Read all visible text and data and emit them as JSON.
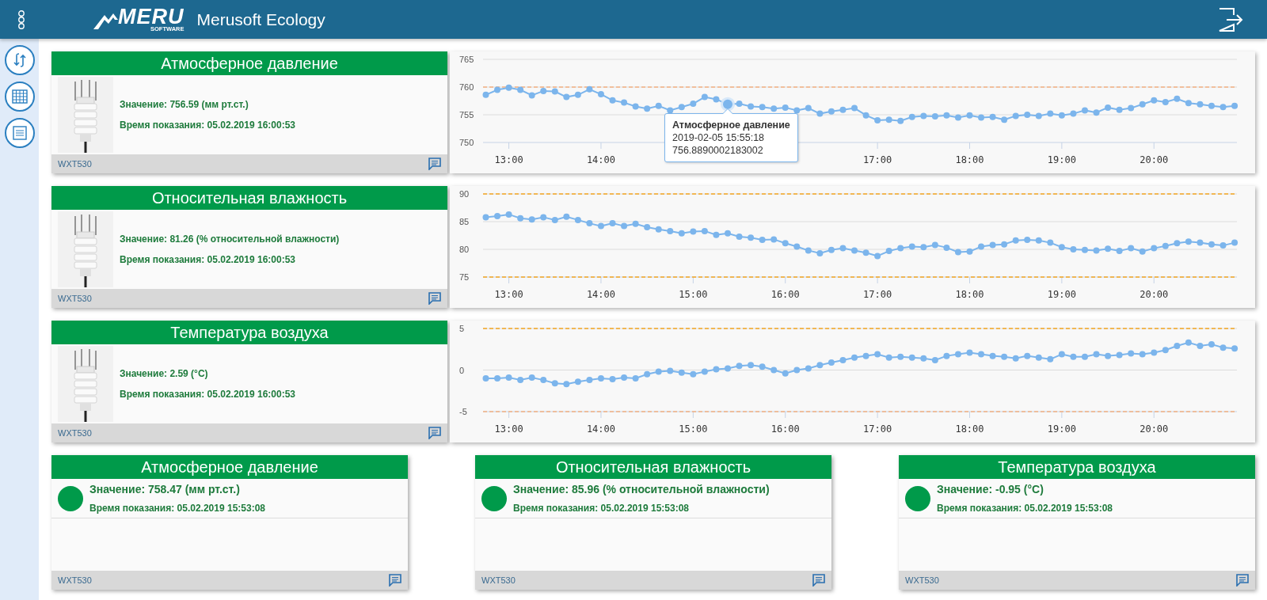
{
  "header": {
    "logo": {
      "text": "MERU",
      "subtext": "SOFTWARE"
    },
    "title": "Merusoft Ecology"
  },
  "sensor_rows": [
    {
      "title": "Атмосферное давление",
      "value": "Значение: 756.59 (мм рт.ст.)",
      "time": "Время показания: 05.02.2019 16:00:53",
      "device": "WXT530",
      "chart_data": {
        "type": "line",
        "xlim": [
          12.72,
          20.9
        ],
        "ylim": [
          750,
          765
        ],
        "yticks": [
          750,
          755,
          760,
          765
        ],
        "xticks": [
          {
            "value": 13,
            "label": "13:00"
          },
          {
            "value": 14,
            "label": "14:00"
          },
          {
            "value": 17,
            "label": "17:00"
          },
          {
            "value": 18,
            "label": "18:00"
          },
          {
            "value": 19,
            "label": "19:00"
          },
          {
            "value": 20,
            "label": "20:00"
          }
        ],
        "x": [
          12.75,
          12.875,
          13,
          13.125,
          13.25,
          13.375,
          13.5,
          13.625,
          13.75,
          13.875,
          14,
          14.125,
          14.25,
          14.375,
          14.5,
          14.625,
          14.75,
          14.875,
          15,
          15.125,
          15.25,
          15.375,
          15.5,
          15.625,
          15.75,
          15.875,
          16,
          16.125,
          16.25,
          16.375,
          16.5,
          16.625,
          16.75,
          16.875,
          17,
          17.125,
          17.25,
          17.375,
          17.5,
          17.625,
          17.75,
          17.875,
          18,
          18.125,
          18.25,
          18.375,
          18.5,
          18.625,
          18.75,
          18.875,
          19,
          19.125,
          19.25,
          19.375,
          19.5,
          19.625,
          19.75,
          19.875,
          20,
          20.125,
          20.25,
          20.375,
          20.5,
          20.625,
          20.75,
          20.875
        ],
        "series": [
          {
            "name": "Атмосферное давление",
            "color": "#7cb5ec",
            "marker": "circle",
            "values": [
              758.6,
              759.5,
              759.9,
              759.5,
              758.5,
              759.3,
              759.2,
              758.2,
              758.6,
              759.6,
              758.7,
              757.6,
              757.2,
              756.5,
              756.1,
              756.6,
              755.8,
              756.4,
              757.0,
              758.2,
              757.8,
              756.9,
              757.0,
              756.5,
              756.4,
              756.1,
              756.3,
              755.8,
              756.2,
              755.2,
              755.6,
              755.9,
              756.2,
              754.9,
              754.0,
              754.1,
              753.9,
              754.6,
              754.8,
              754.7,
              754.9,
              754.5,
              754.9,
              754.5,
              754.6,
              754.1,
              754.8,
              755.0,
              754.8,
              755.2,
              754.9,
              755.2,
              755.8,
              755.4,
              756.3,
              755.9,
              756.2,
              756.9,
              757.6,
              757.3,
              757.9,
              757.1,
              756.9,
              756.6,
              756.4,
              756.6
            ]
          }
        ],
        "ref_lines": [
          {
            "axis": "y",
            "value": 760,
            "color": "#f4b183"
          }
        ],
        "annotations": [
          {
            "x": 15.375,
            "y": 756.9,
            "text": "2019-02-05 15:55:18\n756.8890002183002"
          }
        ]
      }
    },
    {
      "title": "Относительная влажность",
      "value": "Значение: 81.26 (% относительной влажности)",
      "time": "Время показания: 05.02.2019 16:00:53",
      "device": "WXT530",
      "chart_data": {
        "type": "line",
        "xlim": [
          12.72,
          20.9
        ],
        "ylim": [
          75,
          90
        ],
        "yticks": [
          75,
          80,
          85,
          90
        ],
        "xticks": [
          {
            "value": 13,
            "label": "13:00"
          },
          {
            "value": 14,
            "label": "14:00"
          },
          {
            "value": 15,
            "label": "15:00"
          },
          {
            "value": 16,
            "label": "16:00"
          },
          {
            "value": 17,
            "label": "17:00"
          },
          {
            "value": 18,
            "label": "18:00"
          },
          {
            "value": 19,
            "label": "19:00"
          },
          {
            "value": 20,
            "label": "20:00"
          }
        ],
        "x": [
          12.75,
          12.875,
          13,
          13.125,
          13.25,
          13.375,
          13.5,
          13.625,
          13.75,
          13.875,
          14,
          14.125,
          14.25,
          14.375,
          14.5,
          14.625,
          14.75,
          14.875,
          15,
          15.125,
          15.25,
          15.375,
          15.5,
          15.625,
          15.75,
          15.875,
          16,
          16.125,
          16.25,
          16.375,
          16.5,
          16.625,
          16.75,
          16.875,
          17,
          17.125,
          17.25,
          17.375,
          17.5,
          17.625,
          17.75,
          17.875,
          18,
          18.125,
          18.25,
          18.375,
          18.5,
          18.625,
          18.75,
          18.875,
          19,
          19.125,
          19.25,
          19.375,
          19.5,
          19.625,
          19.75,
          19.875,
          20,
          20.125,
          20.25,
          20.375,
          20.5,
          20.625,
          20.75,
          20.875
        ],
        "series": [
          {
            "color": "#7cb5ec",
            "marker": "circle",
            "values": [
              85.8,
              86.0,
              86.3,
              85.6,
              85.4,
              85.8,
              85.3,
              85.9,
              85.3,
              84.7,
              84.2,
              84.7,
              84.2,
              84.6,
              84.0,
              83.6,
              83.3,
              82.9,
              83.2,
              83.3,
              82.6,
              82.9,
              82.3,
              82.1,
              81.7,
              81.8,
              81.1,
              80.5,
              79.8,
              79.3,
              79.9,
              80.2,
              79.8,
              79.4,
              78.8,
              79.7,
              80.2,
              80.5,
              80.4,
              80.8,
              80.3,
              79.5,
              79.6,
              80.5,
              80.8,
              80.9,
              81.6,
              81.7,
              81.6,
              81.2,
              80.4,
              80.0,
              79.9,
              79.8,
              80.1,
              79.7,
              80.2,
              79.6,
              80.2,
              80.6,
              81.1,
              81.4,
              81.2,
              80.9,
              80.7,
              81.2
            ]
          }
        ],
        "ref_lines": [
          {
            "axis": "y",
            "value": 90,
            "color": "#f5a623"
          },
          {
            "axis": "y",
            "value": 75,
            "color": "#f5a623"
          }
        ]
      }
    },
    {
      "title": "Температура воздуха",
      "value": "Значение: 2.59 (°C)",
      "time": "Время показания: 05.02.2019 16:00:53",
      "device": "WXT530",
      "chart_data": {
        "type": "line",
        "xlim": [
          12.72,
          20.9
        ],
        "ylim": [
          -5,
          5
        ],
        "yticks": [
          -5,
          0,
          5
        ],
        "xticks": [
          {
            "value": 13,
            "label": "13:00"
          },
          {
            "value": 14,
            "label": "14:00"
          },
          {
            "value": 15,
            "label": "15:00"
          },
          {
            "value": 16,
            "label": "16:00"
          },
          {
            "value": 17,
            "label": "17:00"
          },
          {
            "value": 18,
            "label": "18:00"
          },
          {
            "value": 19,
            "label": "19:00"
          },
          {
            "value": 20,
            "label": "20:00"
          }
        ],
        "x": [
          12.75,
          12.875,
          13,
          13.125,
          13.25,
          13.375,
          13.5,
          13.625,
          13.75,
          13.875,
          14,
          14.125,
          14.25,
          14.375,
          14.5,
          14.625,
          14.75,
          14.875,
          15,
          15.125,
          15.25,
          15.375,
          15.5,
          15.625,
          15.75,
          15.875,
          16,
          16.125,
          16.25,
          16.375,
          16.5,
          16.625,
          16.75,
          16.875,
          17,
          17.125,
          17.25,
          17.375,
          17.5,
          17.625,
          17.75,
          17.875,
          18,
          18.125,
          18.25,
          18.375,
          18.5,
          18.625,
          18.75,
          18.875,
          19,
          19.125,
          19.25,
          19.375,
          19.5,
          19.625,
          19.75,
          19.875,
          20,
          20.125,
          20.25,
          20.375,
          20.5,
          20.625,
          20.75,
          20.875
        ],
        "series": [
          {
            "color": "#7cb5ec",
            "marker": "circle",
            "values": [
              -1.0,
              -1.0,
              -0.9,
              -1.2,
              -0.9,
              -1.2,
              -1.6,
              -1.7,
              -1.4,
              -1.2,
              -1.0,
              -1.1,
              -0.9,
              -1.0,
              -0.5,
              -0.2,
              -0.1,
              -0.3,
              -0.5,
              -0.2,
              0.1,
              0.2,
              0.5,
              0.6,
              0.4,
              0.0,
              -0.4,
              0.0,
              0.2,
              0.6,
              0.9,
              1.2,
              1.5,
              1.7,
              1.9,
              1.5,
              1.6,
              1.5,
              1.4,
              1.2,
              1.7,
              1.9,
              2.1,
              1.9,
              1.7,
              1.6,
              1.4,
              1.7,
              1.5,
              1.3,
              1.9,
              1.6,
              1.6,
              1.9,
              1.7,
              1.8,
              2.0,
              1.9,
              2.1,
              2.4,
              2.9,
              3.3,
              2.9,
              3.1,
              2.7,
              2.6
            ]
          }
        ],
        "ref_lines": [
          {
            "axis": "y",
            "value": 5,
            "color": "#f5a623"
          },
          {
            "axis": "y",
            "value": -5,
            "color": "#f4b183"
          }
        ]
      }
    }
  ],
  "summary_cards": [
    {
      "title": "Атмосферное давление",
      "value": "Значение: 758.47 (мм рт.ст.)",
      "time": "Время показания: 05.02.2019 15:53:08",
      "color": "#009a4a",
      "device": "WXT530"
    },
    {
      "title": "Относительная влажность",
      "value": "Значение: 85.96 (% относительной влажности)",
      "time": "Время показания: 05.02.2019 15:53:08",
      "color": "#009a4a",
      "device": "WXT530"
    },
    {
      "title": "Температура воздуха",
      "value": "Значение: -0.95 (°C)",
      "time": "Время показания: 05.02.2019 15:53:08",
      "color": "#009a4a",
      "device": "WXT530"
    }
  ]
}
